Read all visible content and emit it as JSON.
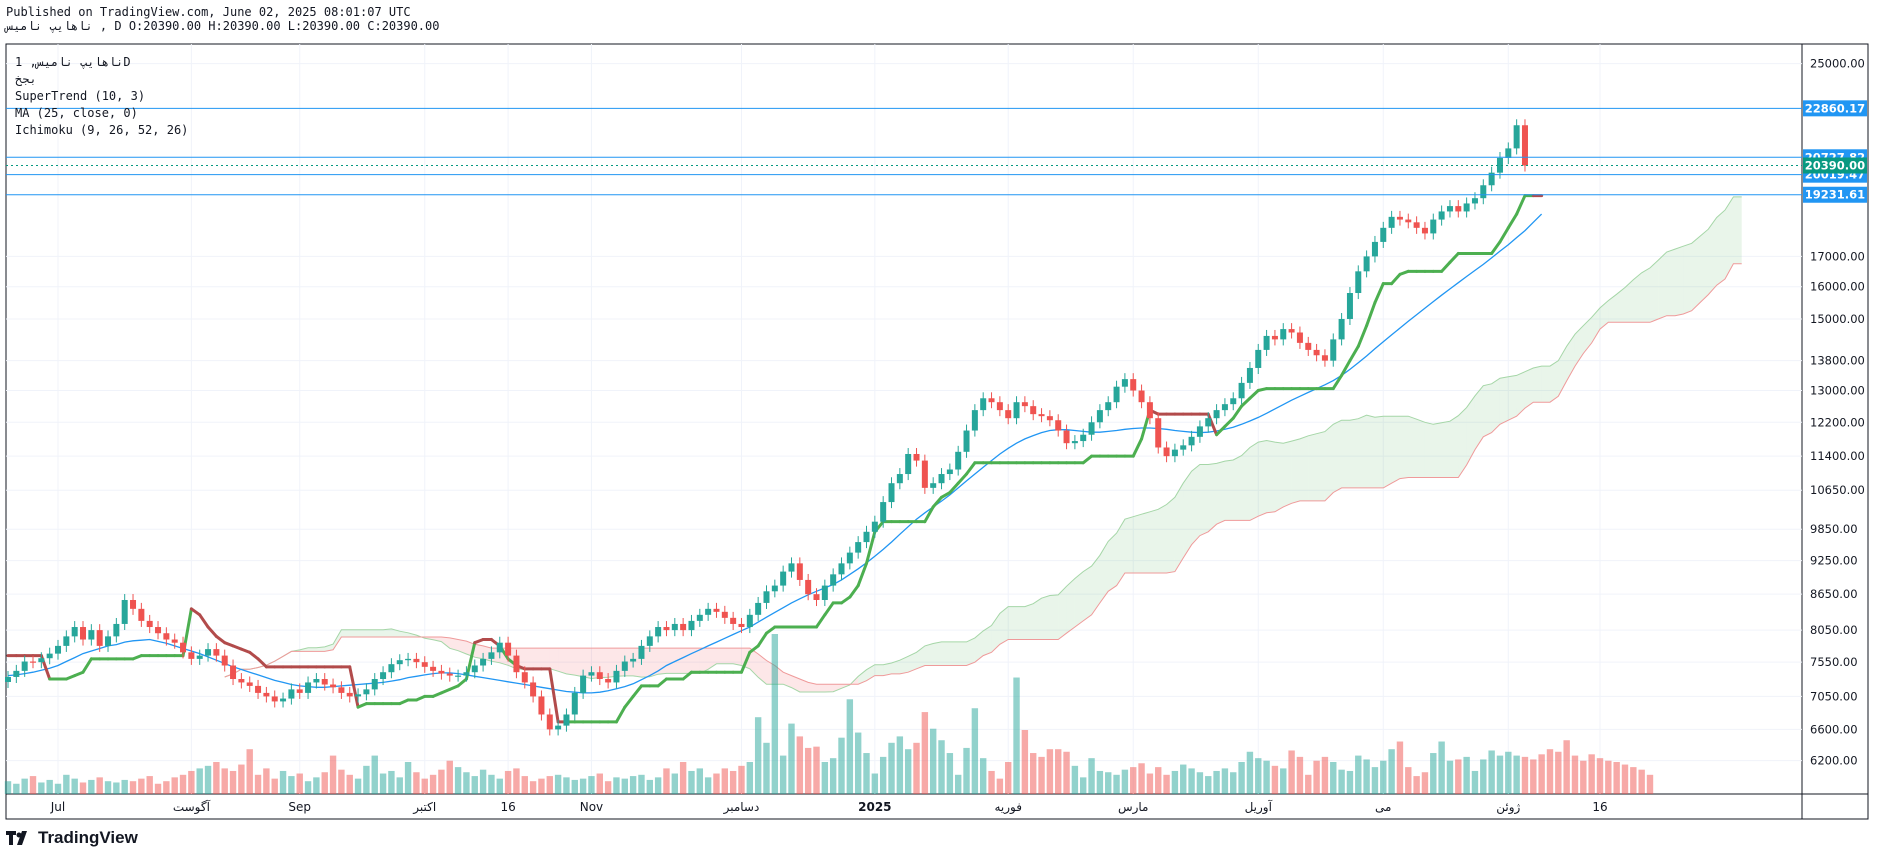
{
  "header": {
    "published": "Published on TradingView.com, June 02, 2025 08:01:07 UTC",
    "ohlc_line": "ناهایپ نامیس , D O:20390.00 H:20390.00 L:20390.00 C:20390.00"
  },
  "legend": {
    "symbol": "ناهایپ نامیس, 1D",
    "market": "بجخ",
    "indicators": [
      "SuperTrend (10, 3)",
      "MA (25, close, 0)",
      "Ichimoku (9, 26, 52, 26)"
    ]
  },
  "brand": {
    "name": "TradingView",
    "icon": "tradingview-logo-icon"
  },
  "colors": {
    "up": "#26a69a",
    "down": "#ef5350",
    "supertrend_up": "#4caf50",
    "supertrend_down": "#b24b4b",
    "ma": "#2196f3",
    "level": "#2196f3",
    "last": "#089981"
  },
  "chart_data": {
    "type": "candlestick",
    "y_scale": "log",
    "ylim": [
      5800,
      26000
    ],
    "y_ticks": [
      "25000.00",
      "17000.00",
      "16000.00",
      "15000.00",
      "13800.00",
      "13000.00",
      "12200.00",
      "11400.00",
      "10650.00",
      "9850.00",
      "9250.00",
      "8650.00",
      "8050.00",
      "7550.00",
      "7050.00",
      "6600.00",
      "6200.00"
    ],
    "x_labels": [
      "Jul",
      "آگوست",
      "Sep",
      "اکتبر",
      "16",
      "Nov",
      "دسامبر",
      "2025",
      "فوریه",
      "مارس",
      "آوریل",
      "می",
      "ژوئن",
      "16"
    ],
    "x_label_index": [
      6,
      22,
      35,
      50,
      60,
      70,
      88,
      104,
      120,
      135,
      150,
      165,
      180,
      191
    ],
    "total_bars": 198,
    "price_levels": [
      {
        "value": 22860.17,
        "label": "22860.17"
      },
      {
        "value": 20727.82,
        "label": "20727.82"
      },
      {
        "value": 20019.47,
        "label": "20019.47"
      },
      {
        "value": 19231.61,
        "label": "19231.61"
      }
    ],
    "last_price": {
      "value": 20390.0,
      "label": "20390.00"
    },
    "close": [
      7330,
      7420,
      7560,
      7550,
      7610,
      7680,
      7800,
      7950,
      8100,
      7900,
      8050,
      7800,
      7950,
      8150,
      8550,
      8400,
      8200,
      8100,
      8000,
      7900,
      7850,
      7700,
      7600,
      7650,
      7750,
      7650,
      7500,
      7300,
      7250,
      7200,
      7100,
      7050,
      6980,
      7020,
      7150,
      7100,
      7250,
      7300,
      7220,
      7180,
      7100,
      7050,
      7080,
      7150,
      7300,
      7400,
      7520,
      7580,
      7600,
      7550,
      7480,
      7420,
      7380,
      7350,
      7350,
      7400,
      7500,
      7600,
      7700,
      7850,
      7650,
      7400,
      7250,
      7050,
      6800,
      6600,
      6650,
      6800,
      7100,
      7350,
      7400,
      7300,
      7250,
      7420,
      7560,
      7600,
      7800,
      7950,
      8100,
      8050,
      8150,
      8050,
      8200,
      8300,
      8400,
      8350,
      8250,
      8150,
      8100,
      8300,
      8500,
      8700,
      8800,
      9050,
      9200,
      8900,
      8650,
      8550,
      8800,
      9000,
      9200,
      9400,
      9600,
      9800,
      10000,
      10400,
      10800,
      11000,
      11450,
      11300,
      10700,
      10800,
      11000,
      11100,
      11500,
      12000,
      12500,
      12800,
      12700,
      12500,
      12300,
      12700,
      12600,
      12400,
      12350,
      12250,
      12000,
      11700,
      11750,
      11900,
      12200,
      12500,
      12700,
      13100,
      13300,
      13000,
      12700,
      12300,
      11600,
      11400,
      11550,
      11650,
      11850,
      12100,
      12300,
      12500,
      12650,
      12800,
      13200,
      13600,
      14100,
      14500,
      14400,
      14700,
      14600,
      14300,
      14100,
      13950,
      13800,
      14400,
      15000,
      15800,
      16500,
      17000,
      17500,
      18000,
      18400,
      18300,
      18200,
      18000,
      17800,
      18300,
      18600,
      18800,
      18600,
      18900,
      19100,
      19600,
      20100,
      20700,
      21100,
      22100,
      20390
    ],
    "volume": [
      1.0,
      0.8,
      1.2,
      1.4,
      0.9,
      1.1,
      0.8,
      1.5,
      1.2,
      0.9,
      1.1,
      1.3,
      1.0,
      0.9,
      1.1,
      1.0,
      1.2,
      1.4,
      0.8,
      1.0,
      1.3,
      1.5,
      1.8,
      2.0,
      2.2,
      2.5,
      2.0,
      1.8,
      2.3,
      3.5,
      1.5,
      2.0,
      1.2,
      1.8,
      1.4,
      1.6,
      1.0,
      1.3,
      1.7,
      3.0,
      1.9,
      1.5,
      1.2,
      2.2,
      3.0,
      1.6,
      1.8,
      1.3,
      2.5,
      1.7,
      1.2,
      1.5,
      1.9,
      2.6,
      2.1,
      1.7,
      1.4,
      1.9,
      1.5,
      1.2,
      1.8,
      2.0,
      1.4,
      1.0,
      1.2,
      1.4,
      1.5,
      1.3,
      1.1,
      1.2,
      1.4,
      1.6,
      1.0,
      1.3,
      1.2,
      1.4,
      1.5,
      1.1,
      1.3,
      2.0,
      1.6,
      2.5,
      1.8,
      2.0,
      1.3,
      1.6,
      2.0,
      1.8,
      2.2,
      2.5,
      6.0,
      4.0,
      12.5,
      3.0,
      5.5,
      4.5,
      3.6,
      3.7,
      2.5,
      2.8,
      4.4,
      7.4,
      4.8,
      3.2,
      1.6,
      2.9,
      4.0,
      4.5,
      3.5,
      4.0,
      6.4,
      5.1,
      4.2,
      3.2,
      1.5,
      3.6,
      6.7,
      2.8,
      1.8,
      1.2,
      2.5,
      9.1,
      5.0,
      3.2,
      2.9,
      3.5,
      3.5,
      3.3,
      2.2,
      1.3,
      2.8,
      1.8,
      1.7,
      1.5,
      1.9,
      2.1,
      2.4,
      1.6,
      2.1,
      1.5,
      1.8,
      2.3,
      2.0,
      1.7,
      1.4,
      1.8,
      2.0,
      1.7,
      2.5,
      3.3,
      2.8,
      2.6,
      2.2,
      2.0,
      3.4,
      2.9,
      1.5,
      2.6,
      2.9,
      2.5,
      1.9,
      1.8,
      3.0,
      2.7,
      2.1,
      2.6,
      3.5,
      4.1,
      2.1,
      1.4,
      1.7,
      3.2,
      4.1,
      2.6,
      2.7,
      2.9,
      1.8,
      2.7,
      3.4,
      3.0,
      3.3,
      3.0,
      2.9,
      2.7,
      3.1,
      3.5,
      3.3,
      4.2,
      3.0,
      2.6,
      3.1,
      2.8,
      2.6,
      2.5,
      2.3,
      2.1,
      1.9,
      1.5
    ],
    "supertrend": [
      7650,
      7650,
      7650,
      7650,
      7650,
      7300,
      7300,
      7300,
      7350,
      7400,
      7600,
      7600,
      7600,
      7600,
      7600,
      7600,
      7650,
      7650,
      7650,
      7650,
      7650,
      7650,
      8400,
      8300,
      8100,
      7950,
      7850,
      7800,
      7750,
      7700,
      7600,
      7480,
      7480,
      7480,
      7480,
      7480,
      7480,
      7480,
      7480,
      7480,
      7480,
      7480,
      6900,
      6950,
      6950,
      6950,
      6950,
      6950,
      7000,
      7000,
      7050,
      7050,
      7100,
      7150,
      7200,
      7300,
      7850,
      7900,
      7900,
      7800,
      7600,
      7500,
      7450,
      7450,
      7450,
      7450,
      6700,
      6700,
      6700,
      6700,
      6700,
      6700,
      6700,
      6700,
      6900,
      7050,
      7200,
      7200,
      7200,
      7300,
      7300,
      7300,
      7400,
      7400,
      7400,
      7400,
      7400,
      7400,
      7400,
      7700,
      7800,
      8000,
      8100,
      8100,
      8100,
      8100,
      8100,
      8100,
      8300,
      8500,
      8500,
      8600,
      8800,
      9200,
      9800,
      10000,
      10000,
      10000,
      10000,
      10000,
      10000,
      10300,
      10500,
      10600,
      10800,
      11000,
      11250,
      11250,
      11250,
      11250,
      11250,
      11250,
      11250,
      11250,
      11250,
      11250,
      11250,
      11250,
      11250,
      11250,
      11400,
      11400,
      11400,
      11400,
      11400,
      11400,
      11800,
      12500,
      12400,
      12400,
      12400,
      12400,
      12400,
      12400,
      12400,
      11900,
      12100,
      12300,
      12600,
      12800,
      13000,
      13050,
      13050,
      13050,
      13050,
      13050,
      13050,
      13050,
      13050,
      13050,
      13400,
      13800,
      14200,
      14800,
      15500,
      16100,
      16100,
      16400,
      16500,
      16500,
      16500,
      16500,
      16500,
      16800,
      17100,
      17100,
      17100,
      17100,
      17100,
      17500,
      18000,
      18500,
      19200,
      19200,
      19200
    ],
    "ma": [
      7350,
      7360,
      7380,
      7400,
      7430,
      7460,
      7500,
      7560,
      7620,
      7680,
      7720,
      7760,
      7800,
      7820,
      7860,
      7880,
      7890,
      7900,
      7870,
      7840,
      7800,
      7760,
      7720,
      7680,
      7630,
      7580,
      7530,
      7480,
      7440,
      7400,
      7360,
      7320,
      7280,
      7250,
      7220,
      7200,
      7190,
      7180,
      7180,
      7190,
      7200,
      7210,
      7220,
      7230,
      7240,
      7250,
      7270,
      7290,
      7320,
      7340,
      7360,
      7380,
      7390,
      7390,
      7380,
      7360,
      7340,
      7320,
      7300,
      7280,
      7260,
      7240,
      7220,
      7200,
      7180,
      7160,
      7140,
      7120,
      7110,
      7100,
      7100,
      7110,
      7130,
      7160,
      7190,
      7230,
      7290,
      7350,
      7420,
      7500,
      7560,
      7620,
      7680,
      7740,
      7800,
      7860,
      7920,
      7980,
      8040,
      8100,
      8180,
      8260,
      8340,
      8420,
      8500,
      8570,
      8640,
      8700,
      8760,
      8820,
      8900,
      9000,
      9100,
      9210,
      9330,
      9460,
      9600,
      9750,
      9900,
      10050,
      10180,
      10300,
      10420,
      10550,
      10700,
      10850,
      11000,
      11150,
      11300,
      11450,
      11580,
      11700,
      11800,
      11880,
      11950,
      12000,
      12020,
      12020,
      12000,
      11980,
      11960,
      11960,
      11980,
      12000,
      12030,
      12050,
      12060,
      12060,
      12050,
      12030,
      12000,
      11980,
      11960,
      11950,
      11960,
      11990,
      12030,
      12080,
      12150,
      12230,
      12320,
      12420,
      12530,
      12640,
      12750,
      12850,
      12950,
      13050,
      13150,
      13260,
      13400,
      13560,
      13740,
      13930,
      14130,
      14330,
      14530,
      14730,
      14930,
      15130,
      15330,
      15530,
      15730,
      15930,
      16130,
      16330,
      16530,
      16730,
      16950,
      17180,
      17400,
      17650,
      17900,
      18200,
      18500
    ]
  }
}
